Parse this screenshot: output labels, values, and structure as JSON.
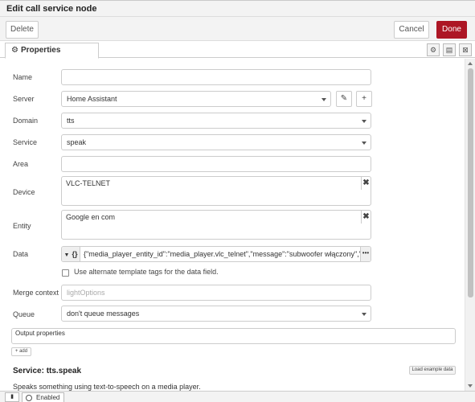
{
  "dialog": {
    "title": "Edit call service node"
  },
  "actions": {
    "delete_label": "Delete",
    "cancel_label": "Cancel",
    "done_label": "Done"
  },
  "tabs": {
    "properties_label": "Properties",
    "icons": [
      "gear-icon",
      "description-icon",
      "appearance-icon"
    ]
  },
  "form": {
    "name": {
      "label": "Name",
      "value": ""
    },
    "server": {
      "label": "Server",
      "value": "Home Assistant"
    },
    "domain": {
      "label": "Domain",
      "value": "tts"
    },
    "service": {
      "label": "Service",
      "value": "speak"
    },
    "area": {
      "label": "Area",
      "value": ""
    },
    "device": {
      "label": "Device",
      "value": "VLC-TELNET"
    },
    "entity": {
      "label": "Entity",
      "value": "Google en com"
    },
    "data": {
      "label": "Data",
      "type_symbol": "{}",
      "value": "{\"media_player_entity_id\":\"media_player.vlc_telnet\",\"message\":\"subwoofer włączony\",\"cache\":tr",
      "expand_label": "•••"
    },
    "alt_tags": {
      "label": "Use alternate template tags for the data field.",
      "checked": false
    },
    "merge_context": {
      "label": "Merge context",
      "placeholder": "lightOptions"
    },
    "queue": {
      "label": "Queue",
      "value": "don't queue messages"
    },
    "output_properties": {
      "label": "Output properties",
      "add_label": "add"
    }
  },
  "service_info": {
    "title": "Service: tts.speak",
    "load_example_label": "Load example data",
    "description": "Speaks something using text-to-speech on a media player."
  },
  "footer": {
    "enabled_label": "Enabled"
  },
  "colors": {
    "done_button": "#ad1625",
    "toolbar_bg": "#f3f3f3",
    "border": "#cccccc"
  }
}
